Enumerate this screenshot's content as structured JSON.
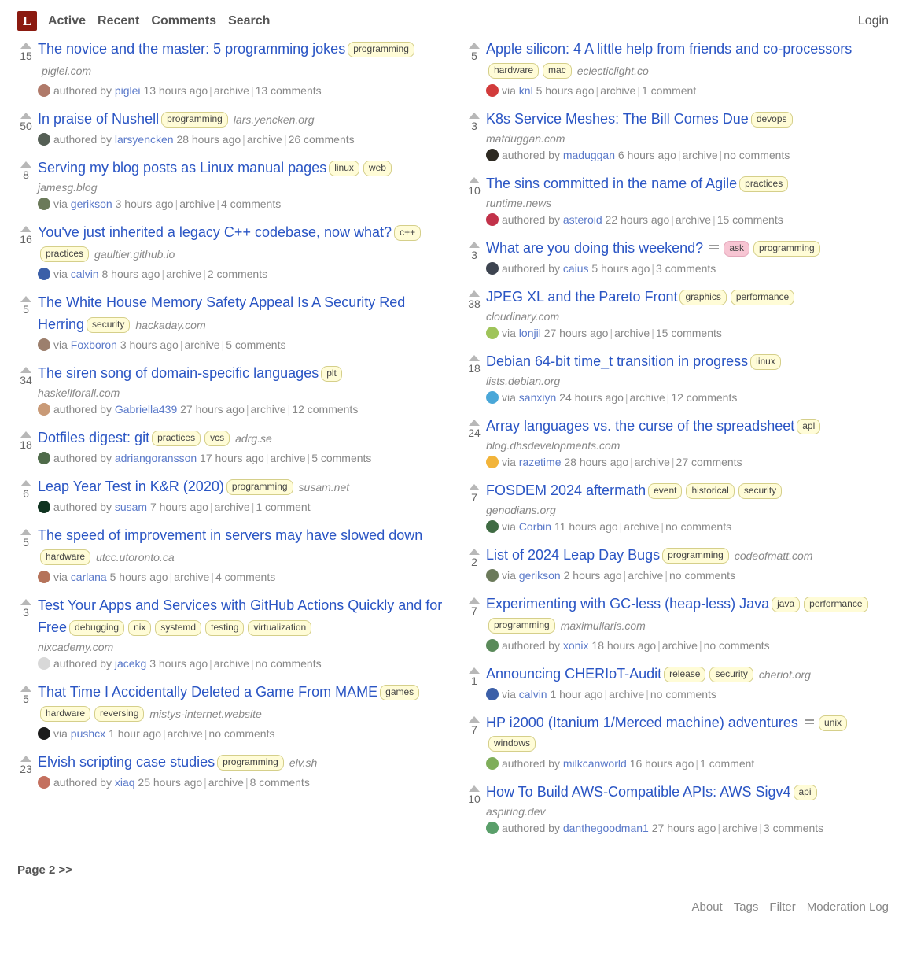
{
  "header": {
    "logo_letter": "L",
    "nav": [
      {
        "label": "Active"
      },
      {
        "label": "Recent"
      },
      {
        "label": "Comments"
      },
      {
        "label": "Search"
      }
    ],
    "login_label": "Login"
  },
  "footer": {
    "pager_label": "Page 2 >>",
    "links": [
      {
        "label": "About"
      },
      {
        "label": "Tags"
      },
      {
        "label": "Filter"
      },
      {
        "label": "Moderation Log"
      }
    ]
  },
  "colors": {
    "logo_bg": "#8b1a10",
    "title_link": "#2a55c4",
    "tag_bg": "#fffcd7",
    "tag_border": "#d5cf8a",
    "ask_tag_bg": "#f7c5d3",
    "byline_link": "#5a79c9",
    "muted_text": "#888888",
    "upvote_arrow": "#b8b8b8"
  },
  "columns": {
    "left": [
      {
        "score": "15",
        "title": "The novice and the master: 5 programming jokes",
        "tags": [
          "programming"
        ],
        "domain": "piglei.com",
        "domain_block": false,
        "has_desc_icon": false,
        "avatar_color": "#b07a6a",
        "submit_verb": "authored by",
        "user": "piglei",
        "age": "13 hours ago",
        "archive_label": "archive",
        "comments_label": "13 comments"
      },
      {
        "score": "50",
        "title": "In praise of Nushell",
        "tags": [
          "programming"
        ],
        "domain": "lars.yencken.org",
        "domain_block": false,
        "has_desc_icon": false,
        "avatar_color": "#555f55",
        "submit_verb": "authored by",
        "user": "larsyencken",
        "age": "28 hours ago",
        "archive_label": "archive",
        "comments_label": "26 comments"
      },
      {
        "score": "8",
        "title": "Serving my blog posts as Linux manual pages",
        "tags": [
          "linux",
          "web"
        ],
        "domain": "jamesg.blog",
        "domain_block": true,
        "has_desc_icon": false,
        "avatar_color": "#6b7a5a",
        "submit_verb": "via",
        "user": "gerikson",
        "age": "3 hours ago",
        "archive_label": "archive",
        "comments_label": "4 comments"
      },
      {
        "score": "16",
        "title": "You've just inherited a legacy C++ codebase, now what?",
        "tags": [
          "c++",
          "practices"
        ],
        "domain": "gaultier.github.io",
        "domain_block": false,
        "has_desc_icon": false,
        "avatar_color": "#3b5fa8",
        "submit_verb": "via",
        "user": "calvin",
        "age": "8 hours ago",
        "archive_label": "archive",
        "comments_label": "2 comments"
      },
      {
        "score": "5",
        "title": "The White House Memory Safety Appeal Is A Security Red Herring",
        "tags": [
          "security"
        ],
        "domain": "hackaday.com",
        "domain_block": false,
        "has_desc_icon": false,
        "avatar_color": "#9c7f6d",
        "submit_verb": "via",
        "user": "Foxboron",
        "age": "3 hours ago",
        "archive_label": "archive",
        "comments_label": "5 comments"
      },
      {
        "score": "34",
        "title": "The siren song of domain-specific languages",
        "tags": [
          "plt"
        ],
        "domain": "haskellforall.com",
        "domain_block": true,
        "has_desc_icon": false,
        "avatar_color": "#c99a77",
        "submit_verb": "authored by",
        "user": "Gabriella439",
        "age": "27 hours ago",
        "archive_label": "archive",
        "comments_label": "12 comments"
      },
      {
        "score": "18",
        "title": "Dotfiles digest: git",
        "tags": [
          "practices",
          "vcs"
        ],
        "domain": "adrg.se",
        "domain_block": false,
        "has_desc_icon": false,
        "avatar_color": "#4f6b4a",
        "submit_verb": "authored by",
        "user": "adriangoransson",
        "age": "17 hours ago",
        "archive_label": "archive",
        "comments_label": "5 comments"
      },
      {
        "score": "6",
        "title": "Leap Year Test in K&R (2020)",
        "tags": [
          "programming"
        ],
        "domain": "susam.net",
        "domain_block": false,
        "has_desc_icon": false,
        "avatar_color": "#0f3320",
        "submit_verb": "authored by",
        "user": "susam",
        "age": "7 hours ago",
        "archive_label": "archive",
        "comments_label": "1 comment"
      },
      {
        "score": "5",
        "title": "The speed of improvement in servers may have slowed down",
        "tags": [
          "hardware"
        ],
        "domain": "utcc.utoronto.ca",
        "domain_block": false,
        "has_desc_icon": false,
        "avatar_color": "#b5735a",
        "submit_verb": "via",
        "user": "carlana",
        "age": "5 hours ago",
        "archive_label": "archive",
        "comments_label": "4 comments"
      },
      {
        "score": "3",
        "title": "Test Your Apps and Services with GitHub Actions Quickly and for Free",
        "tags": [
          "debugging",
          "nix",
          "systemd",
          "testing",
          "virtualization"
        ],
        "domain": "nixcademy.com",
        "domain_block": true,
        "has_desc_icon": false,
        "avatar_color": "#d8d8d8",
        "submit_verb": "authored by",
        "user": "jacekg",
        "age": "3 hours ago",
        "archive_label": "archive",
        "comments_label": "no comments"
      },
      {
        "score": "5",
        "title": "That Time I Accidentally Deleted a Game From MAME",
        "tags": [
          "games",
          "hardware",
          "reversing"
        ],
        "domain": "mistys-internet.website",
        "domain_block": false,
        "has_desc_icon": false,
        "avatar_color": "#1b1b1b",
        "submit_verb": "via",
        "user": "pushcx",
        "age": "1 hour ago",
        "archive_label": "archive",
        "comments_label": "no comments"
      },
      {
        "score": "23",
        "title": "Elvish scripting case studies",
        "tags": [
          "programming"
        ],
        "domain": "elv.sh",
        "domain_block": false,
        "has_desc_icon": false,
        "avatar_color": "#c4705f",
        "submit_verb": "authored by",
        "user": "xiaq",
        "age": "25 hours ago",
        "archive_label": "archive",
        "comments_label": "8 comments"
      }
    ],
    "right": [
      {
        "score": "5",
        "title": "Apple silicon: 4 A little help from friends and co-processors",
        "tags": [
          "hardware",
          "mac"
        ],
        "domain": "eclecticlight.co",
        "domain_block": false,
        "has_desc_icon": false,
        "avatar_color": "#d23b3b",
        "submit_verb": "via",
        "user": "knl",
        "age": "5 hours ago",
        "archive_label": "archive",
        "comments_label": "1 comment"
      },
      {
        "score": "3",
        "title": "K8s Service Meshes: The Bill Comes Due",
        "tags": [
          "devops"
        ],
        "domain": "matduggan.com",
        "domain_block": true,
        "has_desc_icon": false,
        "avatar_color": "#2e2a22",
        "submit_verb": "authored by",
        "user": "maduggan",
        "age": "6 hours ago",
        "archive_label": "archive",
        "comments_label": "no comments"
      },
      {
        "score": "10",
        "title": "The sins committed in the name of Agile",
        "tags": [
          "practices"
        ],
        "domain": "runtime.news",
        "domain_block": true,
        "has_desc_icon": false,
        "avatar_color": "#c2324a",
        "submit_verb": "authored by",
        "user": "asteroid",
        "age": "22 hours ago",
        "archive_label": "archive",
        "comments_label": "15 comments"
      },
      {
        "score": "3",
        "title": "What are you doing this weekend?",
        "tags": [
          "ask",
          "programming"
        ],
        "domain": "",
        "domain_block": false,
        "has_desc_icon": true,
        "avatar_color": "#3d4450",
        "submit_verb": "authored by",
        "user": "caius",
        "age": "5 hours ago",
        "archive_label": "",
        "comments_label": "3 comments"
      },
      {
        "score": "38",
        "title": "JPEG XL and the Pareto Front",
        "tags": [
          "graphics",
          "performance"
        ],
        "domain": "cloudinary.com",
        "domain_block": true,
        "has_desc_icon": false,
        "avatar_color": "#9fc45a",
        "submit_verb": "via",
        "user": "lonjil",
        "age": "27 hours ago",
        "archive_label": "archive",
        "comments_label": "15 comments"
      },
      {
        "score": "18",
        "title": "Debian 64-bit time_t transition in progress",
        "tags": [
          "linux"
        ],
        "domain": "lists.debian.org",
        "domain_block": true,
        "has_desc_icon": false,
        "avatar_color": "#4aa7d8",
        "submit_verb": "via",
        "user": "sanxiyn",
        "age": "24 hours ago",
        "archive_label": "archive",
        "comments_label": "12 comments"
      },
      {
        "score": "24",
        "title": "Array languages vs. the curse of the spreadsheet",
        "tags": [
          "apl"
        ],
        "domain": "blog.dhsdevelopments.com",
        "domain_block": true,
        "has_desc_icon": false,
        "avatar_color": "#f2b43a",
        "submit_verb": "via",
        "user": "razetime",
        "age": "28 hours ago",
        "archive_label": "archive",
        "comments_label": "27 comments"
      },
      {
        "score": "7",
        "title": "FOSDEM 2024 aftermath",
        "tags": [
          "event",
          "historical",
          "security"
        ],
        "domain": "genodians.org",
        "domain_block": true,
        "has_desc_icon": false,
        "avatar_color": "#3f6b43",
        "submit_verb": "via",
        "user": "Corbin",
        "age": "11 hours ago",
        "archive_label": "archive",
        "comments_label": "no comments"
      },
      {
        "score": "2",
        "title": "List of 2024 Leap Day Bugs",
        "tags": [
          "programming"
        ],
        "domain": "codeofmatt.com",
        "domain_block": false,
        "has_desc_icon": false,
        "avatar_color": "#6b7a5a",
        "submit_verb": "via",
        "user": "gerikson",
        "age": "2 hours ago",
        "archive_label": "archive",
        "comments_label": "no comments"
      },
      {
        "score": "7",
        "title": "Experimenting with GC-less (heap-less) Java",
        "tags": [
          "java",
          "performance",
          "programming"
        ],
        "domain": "maximullaris.com",
        "domain_block": false,
        "has_desc_icon": false,
        "avatar_color": "#5a8a5a",
        "submit_verb": "authored by",
        "user": "xonix",
        "age": "18 hours ago",
        "archive_label": "archive",
        "comments_label": "no comments"
      },
      {
        "score": "1",
        "title": "Announcing CHERIoT-Audit",
        "tags": [
          "release",
          "security"
        ],
        "domain": "cheriot.org",
        "domain_block": false,
        "has_desc_icon": false,
        "avatar_color": "#3b5fa8",
        "submit_verb": "via",
        "user": "calvin",
        "age": "1 hour ago",
        "archive_label": "archive",
        "comments_label": "no comments"
      },
      {
        "score": "7",
        "title": "HP i2000 (Itanium 1/Merced machine) adventures",
        "tags": [
          "unix",
          "windows"
        ],
        "domain": "",
        "domain_block": false,
        "has_desc_icon": true,
        "avatar_color": "#7fae5a",
        "submit_verb": "authored by",
        "user": "milkcanworld",
        "age": "16 hours ago",
        "archive_label": "",
        "comments_label": "1 comment"
      },
      {
        "score": "10",
        "title": "How To Build AWS-Compatible APIs: AWS Sigv4",
        "tags": [
          "api"
        ],
        "domain": "aspiring.dev",
        "domain_block": true,
        "has_desc_icon": false,
        "avatar_color": "#5a9f6a",
        "submit_verb": "authored by",
        "user": "danthegoodman1",
        "age": "27 hours ago",
        "archive_label": "archive",
        "comments_label": "3 comments"
      }
    ]
  }
}
